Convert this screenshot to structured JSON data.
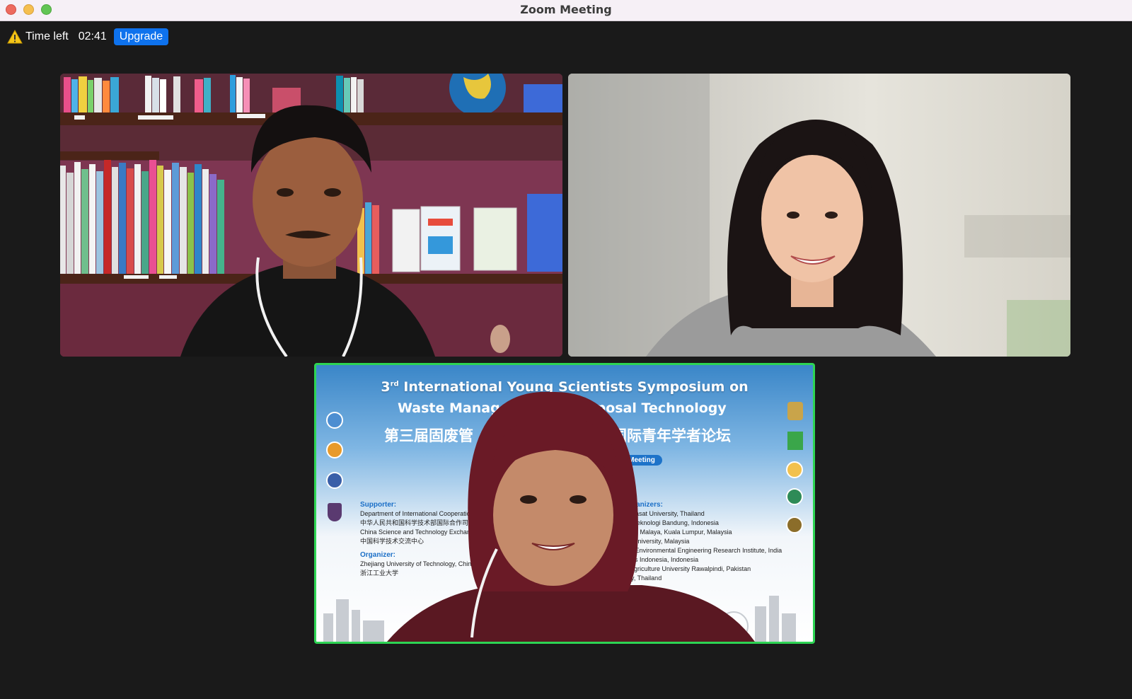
{
  "window": {
    "title": "Zoom Meeting"
  },
  "timer": {
    "label": "Time left",
    "value": "02:41",
    "upgrade_label": "Upgrade"
  },
  "colors": {
    "upgrade_button": "#0e72ed",
    "active_speaker_border": "#2dd453",
    "background": "#1a1a1a"
  },
  "tiles": [
    {
      "name": "participant-video-1"
    },
    {
      "name": "participant-video-2"
    },
    {
      "name": "participant-video-3",
      "active_speaker": true
    }
  ],
  "poster": {
    "title_line1_sup": "rd",
    "title_line1_num": "3",
    "title_line1": "International Young Scientists Symposium on",
    "title_line2_left": "Waste Manage",
    "title_line2_right": "Disposal Technology",
    "chinese_left": "第三届固废管",
    "chinese_right": "国际青年学者论坛",
    "pill": "al Meeting",
    "supporter_heading": "Supporter:",
    "supporter_lines": [
      "Department of International Cooperatio",
      "中华人民共和国科学技术部国际合作司",
      "China Science and Technology Exchange C",
      "中国科学技术交流中心"
    ],
    "organizer_heading": "Organizer:",
    "organizer_lines": [
      "Zhejiang University of Technology, China",
      "浙江工业大学"
    ],
    "coorganizers_heading": "organizers:",
    "coorganizers_lines": [
      "mmasat University, Thailand",
      "tut Teknologi Bandung, Indonesia",
      "ersiti Malaya, Kuala Lumpur, Malaysia",
      "ay University, Malaysia",
      "nal Environmental Engineering Research Institute, India",
      "sitas Indonesia, Indonesia",
      "d Agriculture University Rawalpindi, Pakistan",
      "sity, Thailand"
    ]
  }
}
